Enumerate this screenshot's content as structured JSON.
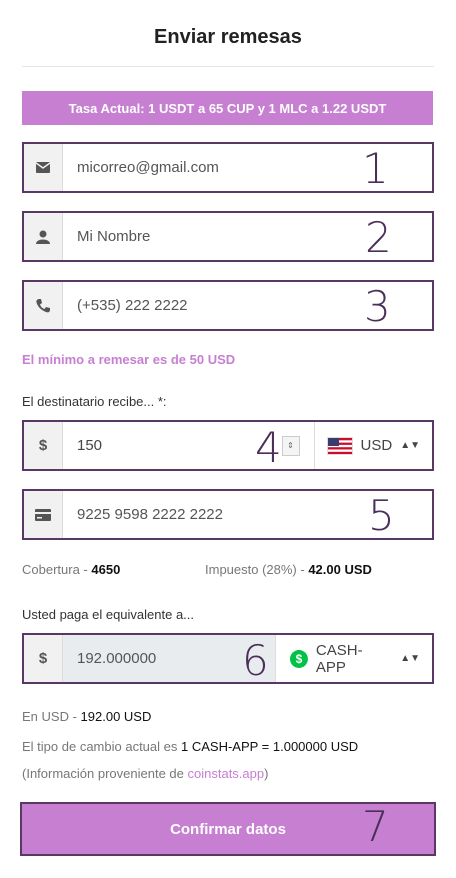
{
  "header": {
    "title": "Enviar remesas"
  },
  "rate_banner": "Tasa Actual: 1 USDT a 65 CUP y 1 MLC a 1.22 USDT",
  "fields": {
    "email": {
      "value": "micorreo@gmail.com",
      "number": "1"
    },
    "name": {
      "value": "Mi Nombre",
      "number": "2"
    },
    "phone": {
      "value": "(+535) 222 2222",
      "number": "3"
    },
    "amount": {
      "value": "150",
      "number": "4",
      "currency_symbol": "$",
      "currency": "USD"
    },
    "card": {
      "value": "9225 9598 2222 2222",
      "number": "5"
    },
    "pay": {
      "value": "192.000000",
      "number": "6",
      "currency_symbol": "$",
      "method": "CASH-APP"
    }
  },
  "minimum_note": "El mínimo a remesar es de 50 USD",
  "recipient_label": "El destinatario recibe... *:",
  "coverage": {
    "label": "Cobertura -",
    "value": "4650"
  },
  "tax": {
    "label": "Impuesto (28%) -",
    "value": "42.00 USD"
  },
  "pay_label": "Usted paga el equivalente a...",
  "in_usd": {
    "label": "En USD -",
    "value": "192.00 USD"
  },
  "exchange": {
    "label": "El tipo de cambio actual es",
    "value": "1 CASH-APP = 1.000000 USD"
  },
  "source": {
    "prefix": "(Información proveniente de",
    "link": "coinstats.app",
    "suffix": ")"
  },
  "submit": {
    "label": "Confirmar datos",
    "number": "7"
  },
  "colors": {
    "accent": "#c67fd1",
    "border": "#5a3866"
  },
  "icons": [
    "envelope-icon",
    "user-icon",
    "phone-icon",
    "dollar-icon",
    "credit-card-icon",
    "cash-app-icon",
    "us-flag-icon"
  ]
}
